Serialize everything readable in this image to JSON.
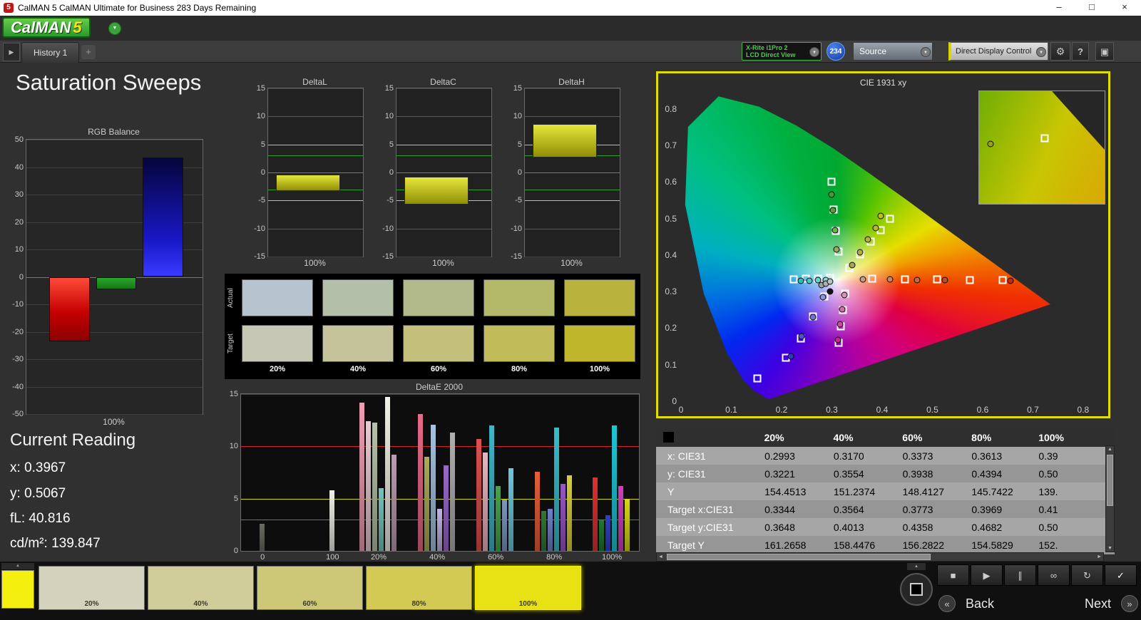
{
  "window": {
    "title": "CalMAN 5 CalMAN Ultimate for Business 283 Days Remaining",
    "app_icon": "5",
    "controls": {
      "minimize": "–",
      "maximize": "□",
      "close": "×"
    }
  },
  "logo": {
    "text": "CalMAN",
    "number": "5",
    "dropdown": "▼"
  },
  "tabs": {
    "active": "History 1",
    "add": "+",
    "expand": "▶"
  },
  "toolbar": {
    "meter_device_line1": "X-Rite i1Pro 2",
    "meter_device_line2": "LCD Direct View",
    "badge": "234",
    "source": "Source",
    "display_control": "Direct Display Control",
    "gear": "⚙",
    "help": "?",
    "layout": "▣",
    "arrow": "▼"
  },
  "page_title": "Saturation Sweeps",
  "current_reading": {
    "title": "Current Reading",
    "items": [
      {
        "label": "x:",
        "value": "0.3967"
      },
      {
        "label": "y:",
        "value": "0.5067"
      },
      {
        "label": "fL:",
        "value": "40.816"
      },
      {
        "label": "cd/m²:",
        "value": "139.847"
      }
    ]
  },
  "chart_data": [
    {
      "id": "rgb_balance",
      "type": "bar",
      "title": "RGB Balance",
      "categories": [
        "Red",
        "Green",
        "Blue"
      ],
      "values": [
        -23.5,
        -4.5,
        43.5
      ],
      "colors": [
        "#e01414",
        "#1f9a1f",
        "#2233ee"
      ],
      "ylim": [
        -50,
        50
      ],
      "yticks": [
        50,
        40,
        30,
        20,
        10,
        0,
        -10,
        -20,
        -30,
        -40,
        -50
      ],
      "xlabel": "100%"
    },
    {
      "id": "deltaL",
      "type": "bar",
      "title": "DeltaL",
      "bar_from": -0.4,
      "bar_to": -3.3,
      "bar_color": "#d8d81e",
      "ylim": [
        -15,
        15
      ],
      "yticks": [
        15,
        10,
        5,
        0,
        -5,
        -10,
        -15
      ],
      "ref_lines": {
        "red": [
          10,
          -10
        ],
        "yellow": [
          5,
          -5
        ],
        "green": [
          3,
          -3
        ]
      },
      "xlabel": "100%"
    },
    {
      "id": "deltaC",
      "type": "bar",
      "title": "DeltaC",
      "bar_from": -0.7,
      "bar_to": -5.7,
      "bar_color": "#d8d81e",
      "ylim": [
        -15,
        15
      ],
      "yticks": [
        15,
        10,
        5,
        0,
        -5,
        -10,
        -15
      ],
      "ref_lines": {
        "red": [
          10,
          -10
        ],
        "yellow": [
          5,
          -5
        ],
        "green": [
          3,
          -3
        ]
      },
      "xlabel": "100%"
    },
    {
      "id": "deltaH",
      "type": "bar",
      "title": "DeltaH",
      "bar_from": 2.7,
      "bar_to": 8.7,
      "bar_color": "#d8d81e",
      "ylim": [
        -15,
        15
      ],
      "yticks": [
        15,
        10,
        5,
        0,
        -5,
        -10,
        -15
      ],
      "ref_lines": {
        "red": [
          10,
          -10
        ],
        "yellow": [
          5,
          -5
        ],
        "green": [
          3,
          -3
        ]
      },
      "xlabel": "100%"
    },
    {
      "id": "deltae2000",
      "type": "bar",
      "title": "DeltaE 2000",
      "ylim": [
        0,
        15
      ],
      "yticks": [
        15,
        10,
        5,
        0
      ],
      "ref_lines": {
        "red": 10,
        "yellow": 5,
        "green": 3
      },
      "groups": [
        {
          "label": "0",
          "bars": [
            {
              "v": 2.6,
              "c": "#6a6a60"
            }
          ]
        },
        {
          "label": "100",
          "bars": [
            {
              "v": 5.8,
              "c": "#efefe6"
            }
          ]
        },
        {
          "label": "20%",
          "bars": [
            {
              "v": 14.2,
              "c": "#ef9fb4"
            },
            {
              "v": 12.4,
              "c": "#e9ccd3"
            },
            {
              "v": 12.3,
              "c": "#b7c3a9"
            },
            {
              "v": 6.0,
              "c": "#74c6be"
            },
            {
              "v": 14.7,
              "c": "#f2f2ea"
            },
            {
              "v": 9.2,
              "c": "#bf9bb4"
            }
          ]
        },
        {
          "label": "40%",
          "bars": [
            {
              "v": 13.1,
              "c": "#e76a87"
            },
            {
              "v": 9.0,
              "c": "#a9ad55"
            },
            {
              "v": 12.1,
              "c": "#a7c3df"
            },
            {
              "v": 4.0,
              "c": "#c3b3e3"
            },
            {
              "v": 8.2,
              "c": "#9b69c7"
            },
            {
              "v": 11.3,
              "c": "#b1b1b1"
            }
          ]
        },
        {
          "label": "60%",
          "bars": [
            {
              "v": 10.7,
              "c": "#df5050"
            },
            {
              "v": 9.4,
              "c": "#efb3bf"
            },
            {
              "v": 12.0,
              "c": "#3fb7c7"
            },
            {
              "v": 6.2,
              "c": "#47a747"
            },
            {
              "v": 4.9,
              "c": "#7f97bf"
            },
            {
              "v": 7.9,
              "c": "#6fc7df"
            }
          ]
        },
        {
          "label": "80%",
          "bars": [
            {
              "v": 7.6,
              "c": "#e75f37"
            },
            {
              "v": 3.8,
              "c": "#2e7933"
            },
            {
              "v": 4.0,
              "c": "#7181c7"
            },
            {
              "v": 11.8,
              "c": "#37bfcb"
            },
            {
              "v": 6.4,
              "c": "#9757c7"
            },
            {
              "v": 7.2,
              "c": "#d7cf3f"
            }
          ]
        },
        {
          "label": "100%",
          "bars": [
            {
              "v": 7.0,
              "c": "#df3030"
            },
            {
              "v": 2.9,
              "c": "#1f772f"
            },
            {
              "v": 3.4,
              "c": "#2f3fcf"
            },
            {
              "v": 12.0,
              "c": "#1fc7d7"
            },
            {
              "v": 6.2,
              "c": "#cf3fbf"
            },
            {
              "v": 5.0,
              "c": "#d7d717"
            }
          ]
        }
      ]
    },
    {
      "id": "cie1931",
      "type": "scatter",
      "title": "CIE 1931 xy",
      "xlim": [
        0,
        0.82
      ],
      "ylim": [
        0,
        0.85
      ],
      "xticks": [
        "0",
        "0.1",
        "0.2",
        "0.3",
        "0.4",
        "0.5",
        "0.6",
        "0.7",
        "0.8"
      ],
      "yticks": [
        "0.8",
        "0.7",
        "0.6",
        "0.5",
        "0.4",
        "0.3",
        "0.2",
        "0.1",
        "0"
      ],
      "targets": [
        [
          0.3344,
          0.3648
        ],
        [
          0.3564,
          0.4013
        ],
        [
          0.3773,
          0.4358
        ],
        [
          0.3969,
          0.4682
        ],
        [
          0.415,
          0.5
        ],
        [
          0.313,
          0.41
        ],
        [
          0.308,
          0.465
        ],
        [
          0.304,
          0.525
        ],
        [
          0.3,
          0.6
        ],
        [
          0.38,
          0.336
        ],
        [
          0.445,
          0.334
        ],
        [
          0.51,
          0.333
        ],
        [
          0.575,
          0.332
        ],
        [
          0.64,
          0.331
        ],
        [
          0.296,
          0.337
        ],
        [
          0.272,
          0.336
        ],
        [
          0.248,
          0.335
        ],
        [
          0.224,
          0.334
        ],
        [
          0.327,
          0.295
        ],
        [
          0.322,
          0.25
        ],
        [
          0.318,
          0.205
        ],
        [
          0.313,
          0.16
        ],
        [
          0.285,
          0.287
        ],
        [
          0.263,
          0.232
        ],
        [
          0.238,
          0.172
        ],
        [
          0.208,
          0.118
        ],
        [
          0.152,
          0.062
        ]
      ],
      "measurements": [
        [
          0.3095,
          0.415,
          "#9aa866"
        ],
        [
          0.306,
          0.468,
          "#7ca84e"
        ],
        [
          0.3025,
          0.522,
          "#55a038"
        ],
        [
          0.299,
          0.565,
          "#3f9c30"
        ],
        [
          0.341,
          0.372,
          "#a8a452"
        ],
        [
          0.356,
          0.408,
          "#b0ab42"
        ],
        [
          0.372,
          0.443,
          "#b9b133"
        ],
        [
          0.387,
          0.473,
          "#c0b524"
        ],
        [
          0.3967,
          0.5067,
          "#c7ba16"
        ],
        [
          0.362,
          0.334,
          "#c49c84"
        ],
        [
          0.415,
          0.333,
          "#c88561"
        ],
        [
          0.47,
          0.332,
          "#c46a42"
        ],
        [
          0.525,
          0.331,
          "#bc4c2c"
        ],
        [
          0.655,
          0.329,
          "#c02818"
        ],
        [
          0.288,
          0.332,
          "#8fd8d2"
        ],
        [
          0.272,
          0.331,
          "#6cd0cc"
        ],
        [
          0.255,
          0.33,
          "#48c8c4"
        ],
        [
          0.238,
          0.329,
          "#28c0bc"
        ],
        [
          0.325,
          0.291,
          "#d892ba"
        ],
        [
          0.3205,
          0.251,
          "#d06fa8"
        ],
        [
          0.316,
          0.21,
          "#c84e97"
        ],
        [
          0.312,
          0.167,
          "#bf2e86"
        ],
        [
          0.283,
          0.284,
          "#8b96d8"
        ],
        [
          0.262,
          0.231,
          "#6a76d0"
        ],
        [
          0.24,
          0.177,
          "#4a57c8"
        ],
        [
          0.218,
          0.123,
          "#2f3cc0"
        ],
        [
          0.296,
          0.3,
          "#141414"
        ],
        [
          0.28,
          0.317,
          "#9aa0a4"
        ],
        [
          0.288,
          0.322,
          "#aab0b2"
        ],
        [
          0.296,
          0.327,
          "#bcc2c0"
        ]
      ],
      "inset": {
        "point_color": "#9aa018"
      }
    }
  ],
  "swatches": {
    "row_labels": [
      "Actual",
      "Target"
    ],
    "col_labels": [
      "20%",
      "40%",
      "60%",
      "80%",
      "100%"
    ],
    "actual_colors": [
      "#b7c3cd",
      "#b4bfa9",
      "#b2ba8c",
      "#b4b96a",
      "#b9b23d"
    ],
    "target_colors": [
      "#c7c7b6",
      "#c5c399",
      "#c3c07c",
      "#c1bc59",
      "#bfb62b"
    ]
  },
  "table": {
    "columns": [
      "20%",
      "40%",
      "60%",
      "80%",
      "100%"
    ],
    "rows": [
      {
        "label": "x: CIE31",
        "values": [
          "0.2993",
          "0.3170",
          "0.3373",
          "0.3613",
          "0.39"
        ]
      },
      {
        "label": "y: CIE31",
        "values": [
          "0.3221",
          "0.3554",
          "0.3938",
          "0.4394",
          "0.50"
        ]
      },
      {
        "label": "Y",
        "values": [
          "154.4513",
          "151.2374",
          "148.4127",
          "145.7422",
          "139."
        ]
      },
      {
        "label": "Target x:CIE31",
        "values": [
          "0.3344",
          "0.3564",
          "0.3773",
          "0.3969",
          "0.41"
        ]
      },
      {
        "label": "Target y:CIE31",
        "values": [
          "0.3648",
          "0.4013",
          "0.4358",
          "0.4682",
          "0.50"
        ]
      },
      {
        "label": "Target Y",
        "values": [
          "161.2658",
          "158.4476",
          "156.2822",
          "154.5829",
          "152."
        ]
      }
    ]
  },
  "bottom": {
    "current_color": "#f4ef0e",
    "swatches": [
      {
        "label": "20%",
        "color": "#d3d2bc",
        "selected": false
      },
      {
        "label": "40%",
        "color": "#d0cd9a",
        "selected": false
      },
      {
        "label": "60%",
        "color": "#cdc878",
        "selected": false
      },
      {
        "label": "80%",
        "color": "#d2ca52",
        "selected": false
      },
      {
        "label": "100%",
        "color": "#e8e214",
        "selected": true
      }
    ],
    "transport": [
      {
        "name": "stop",
        "glyph": "■"
      },
      {
        "name": "play",
        "glyph": "▶"
      },
      {
        "name": "pause",
        "glyph": "∥"
      },
      {
        "name": "continuous",
        "glyph": "∞"
      },
      {
        "name": "loop",
        "glyph": "↻"
      },
      {
        "name": "accept",
        "glyph": "✓"
      }
    ],
    "back_label": "Back",
    "next_label": "Next",
    "back_icon": "«",
    "next_icon": "»"
  }
}
